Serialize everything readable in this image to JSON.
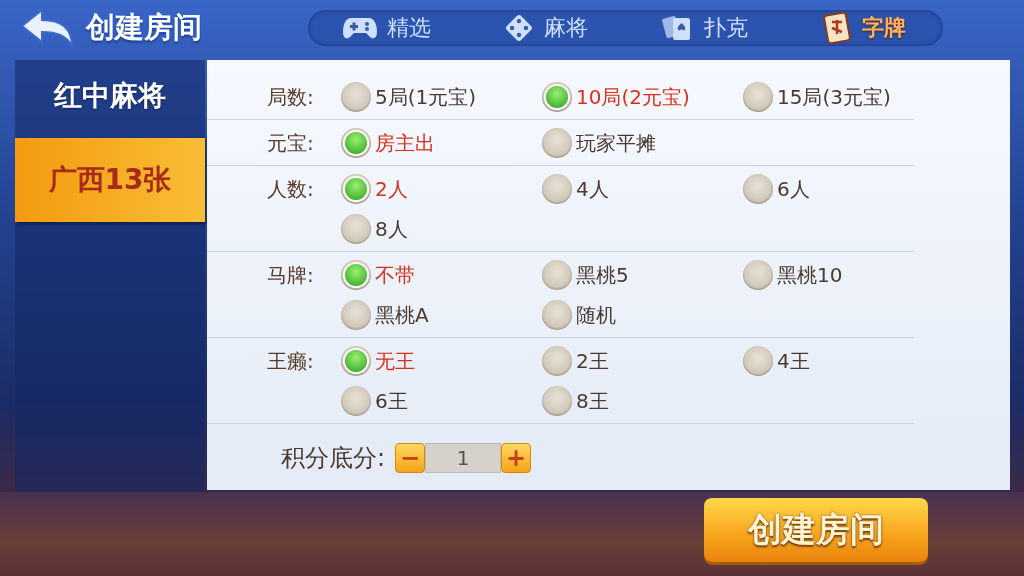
{
  "header": {
    "title": "创建房间"
  },
  "tabs": [
    {
      "label": "精选",
      "selected": false
    },
    {
      "label": "麻将",
      "selected": false
    },
    {
      "label": "扑克",
      "selected": false
    },
    {
      "label": "字牌",
      "selected": true
    }
  ],
  "sidebar": {
    "items": [
      {
        "label": "红中麻将",
        "selected": false
      },
      {
        "label": "广西13张",
        "selected": true
      }
    ]
  },
  "groups": [
    {
      "label": "局数:",
      "options": [
        {
          "label": "5局(1元宝)",
          "selected": false
        },
        {
          "label": "10局(2元宝)",
          "selected": true
        },
        {
          "label": "15局(3元宝)",
          "selected": false
        }
      ]
    },
    {
      "label": "元宝:",
      "options": [
        {
          "label": "房主出",
          "selected": true
        },
        {
          "label": "玩家平摊",
          "selected": false
        }
      ]
    },
    {
      "label": "人数:",
      "options": [
        {
          "label": "2人",
          "selected": true
        },
        {
          "label": "4人",
          "selected": false
        },
        {
          "label": "6人",
          "selected": false
        },
        {
          "label": "8人",
          "selected": false
        }
      ]
    },
    {
      "label": "马牌:",
      "options": [
        {
          "label": "不带",
          "selected": true
        },
        {
          "label": "黑桃5",
          "selected": false
        },
        {
          "label": "黑桃10",
          "selected": false
        },
        {
          "label": "黑桃A",
          "selected": false
        },
        {
          "label": "随机",
          "selected": false
        }
      ]
    },
    {
      "label": "王癞:",
      "options": [
        {
          "label": "无王",
          "selected": true
        },
        {
          "label": "2王",
          "selected": false
        },
        {
          "label": "4王",
          "selected": false
        },
        {
          "label": "6王",
          "selected": false
        },
        {
          "label": "8王",
          "selected": false
        }
      ]
    }
  ],
  "score": {
    "label": "积分底分:",
    "minus": "−",
    "value": "1",
    "plus": "+"
  },
  "create_button": "创建房间"
}
